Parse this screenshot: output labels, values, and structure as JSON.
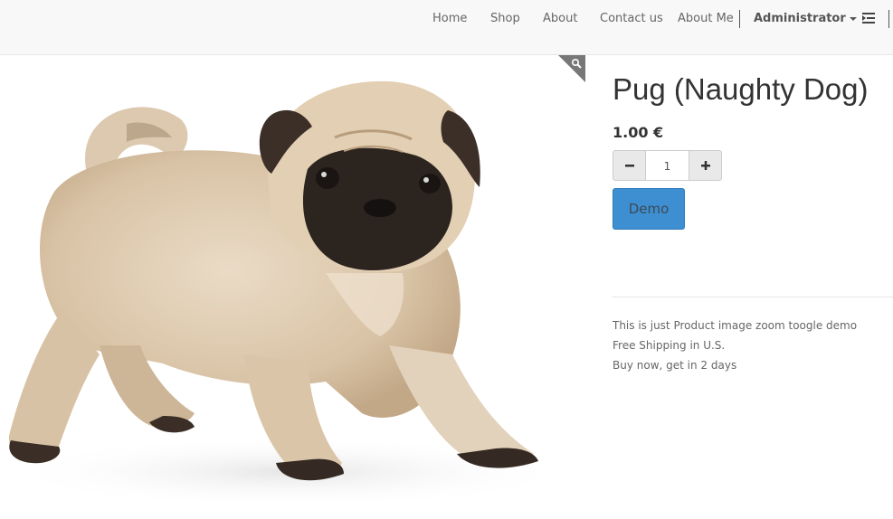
{
  "nav": {
    "items": [
      {
        "label": "Home"
      },
      {
        "label": "Shop"
      },
      {
        "label": "About"
      },
      {
        "label": "Contact us"
      },
      {
        "label": "About Me"
      }
    ],
    "user": "Administrator",
    "menu_icon": "list-indent-icon"
  },
  "product": {
    "name": "Pug (Naughty Dog)",
    "price": "1.00 €",
    "quantity": "1",
    "button_label": "Demo",
    "description": [
      "This is just Product image zoom toogle demo",
      "Free Shipping in U.S.",
      "Buy now, get in 2 days"
    ],
    "image_icon": "pug-puppy-image",
    "zoom_icon": "magnifier-icon"
  },
  "colors": {
    "navbar_bg": "#f8f8f8",
    "primary": "#3e8fd1",
    "zoom_corner": "#777777"
  }
}
